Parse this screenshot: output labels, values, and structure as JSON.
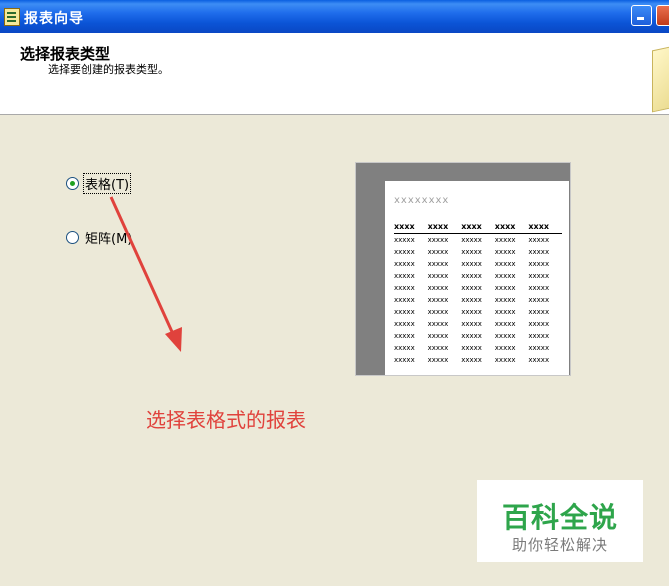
{
  "window": {
    "title": "报表向导"
  },
  "header": {
    "title": "选择报表类型",
    "subtitle": "选择要创建的报表类型。"
  },
  "options": [
    {
      "label": "表格(T)",
      "checked": true
    },
    {
      "label": "矩阵(M)",
      "checked": false
    }
  ],
  "preview": {
    "title": "xxxxxxxx",
    "headers": [
      "xxxx",
      "xxxx",
      "xxxx",
      "xxxx",
      "xxxx"
    ],
    "cell": "xxxxx"
  },
  "annotation": "选择表格式的报表",
  "watermark": {
    "main": "百科全说",
    "sub": "助你轻松解决"
  },
  "colors": {
    "titlebar": "#0A5FE0",
    "dialog_bg": "#ECE9D8",
    "annotation": "#E0423C",
    "watermark_green": "#2EA54B"
  }
}
